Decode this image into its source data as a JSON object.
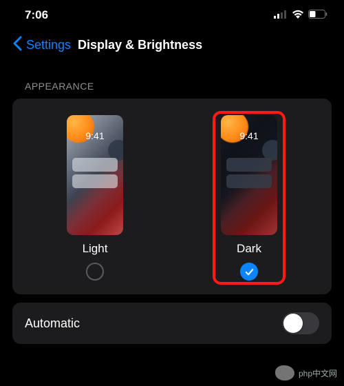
{
  "status": {
    "time": "7:06",
    "signal": 2,
    "wifi": true,
    "battery": 38
  },
  "nav": {
    "back_label": "Settings",
    "title": "Display & Brightness"
  },
  "appearance": {
    "section_header": "APPEARANCE",
    "light": {
      "label": "Light",
      "preview_time": "9:41",
      "selected": false
    },
    "dark": {
      "label": "Dark",
      "preview_time": "9:41",
      "selected": true
    }
  },
  "automatic": {
    "label": "Automatic",
    "enabled": false
  },
  "watermark": {
    "text": "php中文网"
  }
}
